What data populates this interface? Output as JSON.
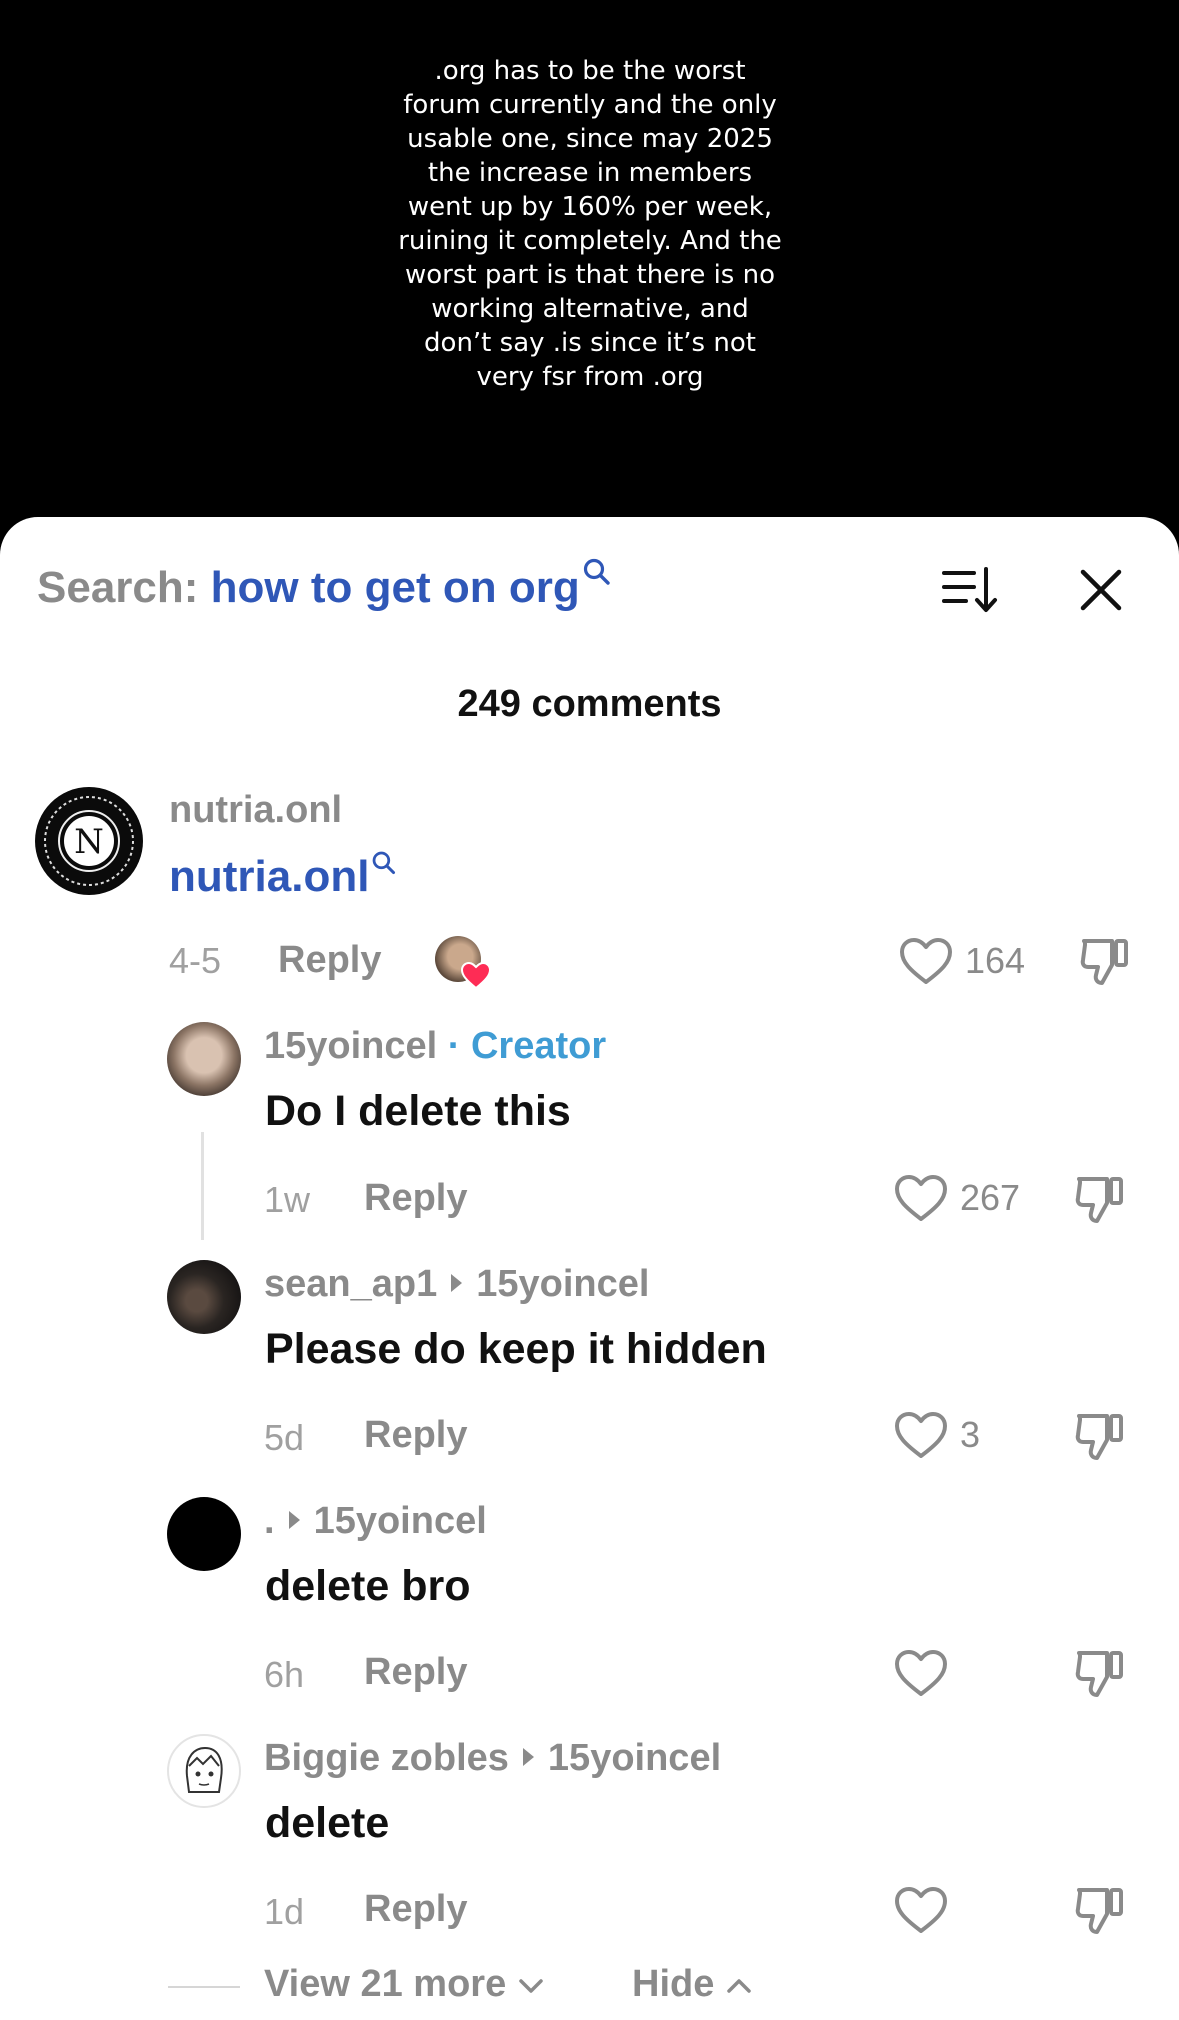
{
  "video": {
    "caption": ".org has to be the worst\nforum currently and the only\nusable one, since may 2025\nthe increase in members\nwent up by 160% per week,\nruining it completely. And the\nworst part is that there is no\nworking alternative, and\ndon’t say .is since it’s not\nvery fsr from .org"
  },
  "header": {
    "search_label": "Search:",
    "search_query": "how to get on org",
    "sort_icon": "sort-icon",
    "close_icon": "close-icon"
  },
  "comment_count": "249 comments",
  "comments": [
    {
      "username": "nutria.onl",
      "text": "nutria.onl",
      "date": "4-5",
      "reply_label": "Reply",
      "likes": "164",
      "avatar_letter": "N"
    }
  ],
  "replies": [
    {
      "username": "15yoincel",
      "badge": "· Creator",
      "target": "",
      "text": "Do I delete this",
      "date": "1w",
      "reply_label": "Reply",
      "likes": "267"
    },
    {
      "username": "sean_ap1",
      "badge": "",
      "target": "15yoincel",
      "text": "Please do keep it hidden",
      "date": "5d",
      "reply_label": "Reply",
      "likes": "3"
    },
    {
      "username": ".",
      "badge": "",
      "target": "15yoincel",
      "text": "delete bro",
      "date": "6h",
      "reply_label": "Reply",
      "likes": ""
    },
    {
      "username": "Biggie zobles",
      "badge": "",
      "target": "15yoincel",
      "text": "delete",
      "date": "1d",
      "reply_label": "Reply",
      "likes": ""
    }
  ],
  "footer": {
    "view_more": "View 21 more",
    "hide": "Hide"
  },
  "colors": {
    "accent_blue": "#2f57b7",
    "creator_blue": "#3f9cd4",
    "heart_red": "#fe2c55"
  }
}
